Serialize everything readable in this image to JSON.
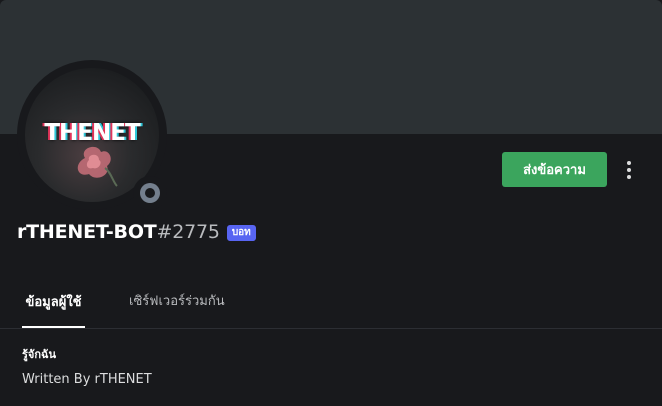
{
  "avatar": {
    "logo_text": "THENET",
    "status": "offline",
    "status_color": "#747f8d"
  },
  "actions": {
    "send_message_label": "ส่งข้อความ",
    "send_message_color": "#3ba55d",
    "more_icon": "more-vertical-icon"
  },
  "profile": {
    "username": "rTHENET-BOT",
    "discriminator": "#2775",
    "badge": "บอท",
    "badge_color": "#5865f2"
  },
  "tabs": [
    {
      "label": "ข้อมูลผู้ใช้",
      "active": true
    },
    {
      "label": "เซิร์ฟเวอร์ร่วมกัน",
      "active": false
    }
  ],
  "about": {
    "title": "รู้จักฉัน",
    "text": "Written By rTHENET"
  },
  "colors": {
    "background": "#18191c",
    "banner": "#2c3134"
  }
}
